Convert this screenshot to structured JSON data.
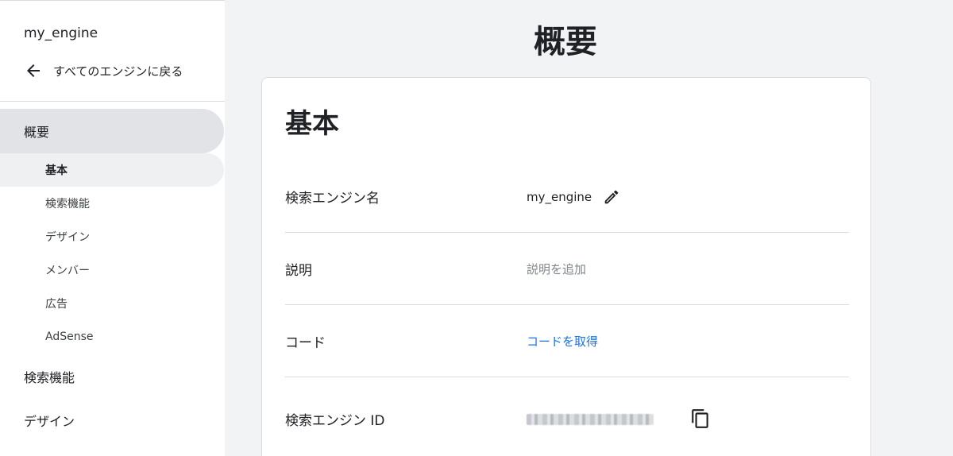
{
  "sidebar": {
    "engine_name": "my_engine",
    "back_label": "すべてのエンジンに戻る",
    "nav": [
      {
        "label": "概要",
        "level": "main",
        "active": true
      },
      {
        "label": "基本",
        "level": "sub",
        "active": true
      },
      {
        "label": "検索機能",
        "level": "sub",
        "active": false
      },
      {
        "label": "デザイン",
        "level": "sub",
        "active": false
      },
      {
        "label": "メンバー",
        "level": "sub",
        "active": false
      },
      {
        "label": "広告",
        "level": "sub",
        "active": false
      },
      {
        "label": "AdSense",
        "level": "sub",
        "active": false
      },
      {
        "label": "検索機能",
        "level": "main",
        "active": false
      },
      {
        "label": "デザイン",
        "level": "main",
        "active": false
      }
    ]
  },
  "main": {
    "page_title": "概要",
    "card": {
      "title": "基本",
      "rows": [
        {
          "label": "検索エンジン名",
          "value": "my_engine",
          "action": "pencil-icon"
        },
        {
          "label": "説明",
          "value": "説明を追加"
        },
        {
          "label": "コード",
          "value": "コードを取得"
        },
        {
          "label": "検索エンジン ID",
          "action": "copy-icon"
        }
      ]
    }
  },
  "colors": {
    "link": "#1a73e8",
    "active_nav_bg": "#e1e3e6",
    "page_bg": "#f1f3f4"
  }
}
